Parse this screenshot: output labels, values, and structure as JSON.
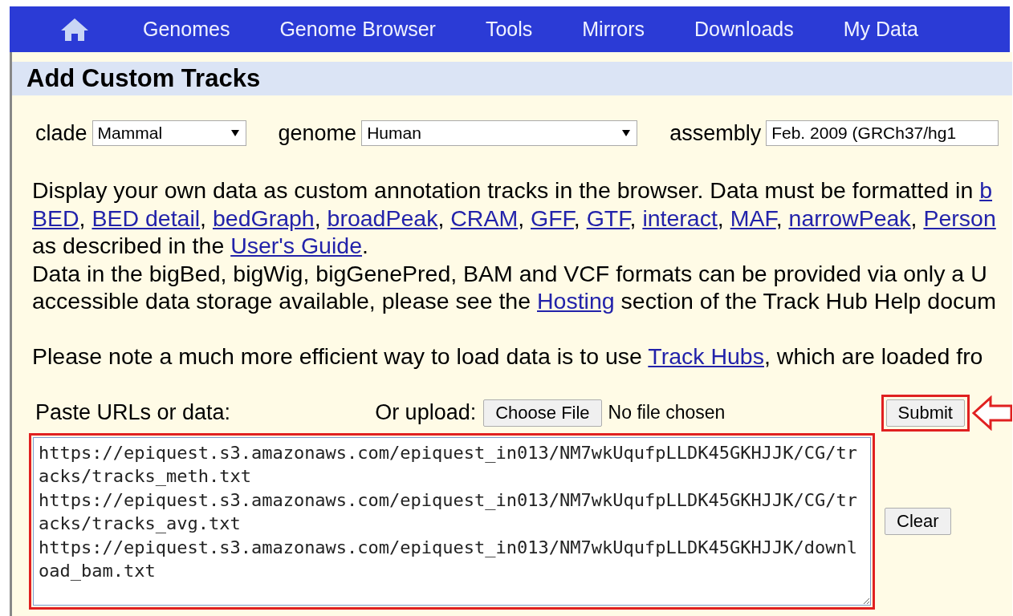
{
  "nav": {
    "items": [
      "Genomes",
      "Genome Browser",
      "Tools",
      "Mirrors",
      "Downloads",
      "My Data"
    ]
  },
  "title": "Add Custom Tracks",
  "selectors": [
    {
      "label": "clade",
      "value": "Mammal",
      "kind": "dropdown"
    },
    {
      "label": "genome",
      "value": "Human",
      "kind": "dropdown"
    },
    {
      "label": "assembly",
      "value": "Feb. 2009 (GRCh37/hg1",
      "kind": "cut"
    }
  ],
  "description": [
    [
      [
        {
          "text": "Display your own data as custom annotation tracks in the browser. Data must be formatted in ",
          "link": false
        },
        {
          "text": "b",
          "link": true
        }
      ],
      [
        {
          "text": "BED",
          "link": true
        },
        {
          "text": ", ",
          "link": false
        },
        {
          "text": "BED detail",
          "link": true
        },
        {
          "text": ", ",
          "link": false
        },
        {
          "text": "bedGraph",
          "link": true
        },
        {
          "text": ", ",
          "link": false
        },
        {
          "text": "broadPeak",
          "link": true
        },
        {
          "text": ", ",
          "link": false
        },
        {
          "text": "CRAM",
          "link": true
        },
        {
          "text": ", ",
          "link": false
        },
        {
          "text": "GFF",
          "link": true
        },
        {
          "text": ", ",
          "link": false
        },
        {
          "text": "GTF",
          "link": true
        },
        {
          "text": ", ",
          "link": false
        },
        {
          "text": "interact",
          "link": true
        },
        {
          "text": ", ",
          "link": false
        },
        {
          "text": "MAF",
          "link": true
        },
        {
          "text": ", ",
          "link": false
        },
        {
          "text": "narrowPeak",
          "link": true
        },
        {
          "text": ", ",
          "link": false
        },
        {
          "text": "Person",
          "link": true
        }
      ],
      [
        {
          "text": "as described in the ",
          "link": false
        },
        {
          "text": "User's Guide",
          "link": true
        },
        {
          "text": ".",
          "link": false
        }
      ],
      [
        {
          "text": "Data in the bigBed, bigWig, bigGenePred, BAM and VCF formats can be provided via only a U",
          "link": false
        }
      ],
      [
        {
          "text": "accessible data storage available, please see the ",
          "link": false
        },
        {
          "text": "Hosting",
          "link": true
        },
        {
          "text": " section of the Track Hub Help docum",
          "link": false
        }
      ]
    ],
    [
      [
        {
          "text": "Please note a much more efficient way to load data is to use ",
          "link": false
        },
        {
          "text": "Track Hubs",
          "link": true
        },
        {
          "text": ", which are loaded fro",
          "link": false
        }
      ]
    ]
  ],
  "paste_label": "Paste URLs or data:",
  "upload_label": "Or upload:",
  "choose_file": "Choose File",
  "file_status": "No file chosen",
  "submit": {
    "label": "Submit",
    "highlighted": true
  },
  "clear": "Clear",
  "data": {
    "value": "https://epiquest.s3.amazonaws.com/epiquest_in013/NM7wkUqufpLLDK45GKHJJK/CG/tracks/tracks_meth.txt\nhttps://epiquest.s3.amazonaws.com/epiquest_in013/NM7wkUqufpLLDK45GKHJJK/CG/tracks/tracks_avg.txt\nhttps://epiquest.s3.amazonaws.com/epiquest_in013/NM7wkUqufpLLDK45GKHJJK/download_bam.txt\n",
    "highlighted": true
  }
}
